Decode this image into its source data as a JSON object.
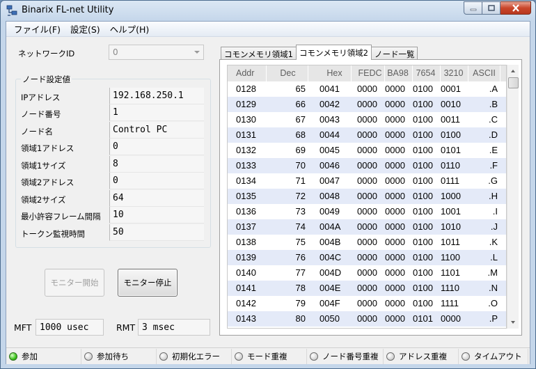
{
  "window": {
    "title": "Binarix FL-net Utility"
  },
  "menu": [
    {
      "label": "ファイル(F)"
    },
    {
      "label": "設定(S)"
    },
    {
      "label": "ヘルプ(H)"
    }
  ],
  "network": {
    "label": "ネットワークID",
    "value": "0"
  },
  "node_settings": {
    "title": "ノード設定値",
    "fields": [
      {
        "label": "IPアドレス",
        "value": "192.168.250.1"
      },
      {
        "label": "ノード番号",
        "value": "1"
      },
      {
        "label": "ノード名",
        "value": "Control PC"
      },
      {
        "label": "領域1アドレス",
        "value": "0"
      },
      {
        "label": "領域1サイズ",
        "value": "8"
      },
      {
        "label": "領域2アドレス",
        "value": "0"
      },
      {
        "label": "領域2サイズ",
        "value": "64"
      },
      {
        "label": "最小許容フレーム間隔",
        "value": "10"
      },
      {
        "label": "トークン監視時間",
        "value": "50"
      }
    ]
  },
  "buttons": {
    "start": "モニター開始",
    "stop": "モニター停止"
  },
  "timing": {
    "mft_label": "MFT",
    "mft_value": "1000 usec",
    "rmt_label": "RMT",
    "rmt_value": "3 msec"
  },
  "tabs": [
    {
      "label": "コモンメモリ領域1",
      "selected": false
    },
    {
      "label": "コモンメモリ領域2",
      "selected": true
    },
    {
      "label": "ノード一覧",
      "selected": false
    }
  ],
  "grid": {
    "headers": [
      "Addr",
      "Dec",
      "Hex",
      "FEDC",
      "BA98",
      "7654",
      "3210",
      "ASCII"
    ],
    "rows": [
      [
        "0128",
        "65",
        "0041",
        "0000",
        "0000",
        "0100",
        "0001",
        ".A"
      ],
      [
        "0129",
        "66",
        "0042",
        "0000",
        "0000",
        "0100",
        "0010",
        ".B"
      ],
      [
        "0130",
        "67",
        "0043",
        "0000",
        "0000",
        "0100",
        "0011",
        ".C"
      ],
      [
        "0131",
        "68",
        "0044",
        "0000",
        "0000",
        "0100",
        "0100",
        ".D"
      ],
      [
        "0132",
        "69",
        "0045",
        "0000",
        "0000",
        "0100",
        "0101",
        ".E"
      ],
      [
        "0133",
        "70",
        "0046",
        "0000",
        "0000",
        "0100",
        "0110",
        ".F"
      ],
      [
        "0134",
        "71",
        "0047",
        "0000",
        "0000",
        "0100",
        "0111",
        ".G"
      ],
      [
        "0135",
        "72",
        "0048",
        "0000",
        "0000",
        "0100",
        "1000",
        ".H"
      ],
      [
        "0136",
        "73",
        "0049",
        "0000",
        "0000",
        "0100",
        "1001",
        ".I"
      ],
      [
        "0137",
        "74",
        "004A",
        "0000",
        "0000",
        "0100",
        "1010",
        ".J"
      ],
      [
        "0138",
        "75",
        "004B",
        "0000",
        "0000",
        "0100",
        "1011",
        ".K"
      ],
      [
        "0139",
        "76",
        "004C",
        "0000",
        "0000",
        "0100",
        "1100",
        ".L"
      ],
      [
        "0140",
        "77",
        "004D",
        "0000",
        "0000",
        "0100",
        "1101",
        ".M"
      ],
      [
        "0141",
        "78",
        "004E",
        "0000",
        "0000",
        "0100",
        "1110",
        ".N"
      ],
      [
        "0142",
        "79",
        "004F",
        "0000",
        "0000",
        "0100",
        "1111",
        ".O"
      ],
      [
        "0143",
        "80",
        "0050",
        "0000",
        "0000",
        "0101",
        "0000",
        ".P"
      ]
    ]
  },
  "status": [
    {
      "label": "参加",
      "on": true
    },
    {
      "label": "参加待ち",
      "on": false
    },
    {
      "label": "初期化エラー",
      "on": false
    },
    {
      "label": "モード重複",
      "on": false
    },
    {
      "label": "ノード番号重複",
      "on": false
    },
    {
      "label": "アドレス重複",
      "on": false
    },
    {
      "label": "タイムアウト",
      "on": false
    }
  ],
  "colors": {
    "grid_alt_row": "#e4eaf8",
    "status_on": "#3bc21b"
  }
}
